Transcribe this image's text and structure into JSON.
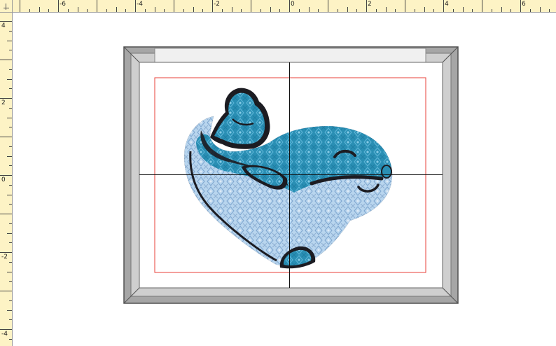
{
  "rulers": {
    "horizontal": {
      "origin_label": "0",
      "labels": [
        {
          "text": "-6",
          "value": -6
        },
        {
          "text": "-4",
          "value": -4
        },
        {
          "text": "-2",
          "value": -2
        },
        {
          "text": "0",
          "value": 0
        },
        {
          "text": "2",
          "value": 2
        },
        {
          "text": "4",
          "value": 4
        },
        {
          "text": "6",
          "value": 6
        }
      ]
    },
    "vertical": {
      "labels": [
        {
          "text": "4",
          "value": 4
        },
        {
          "text": "2",
          "value": 2
        },
        {
          "text": "0",
          "value": 0
        },
        {
          "text": "-2",
          "value": -2
        },
        {
          "text": "-4",
          "value": -4
        }
      ]
    }
  },
  "design": {
    "subject": "whale embroidery design",
    "colors": {
      "body_dark": "#2a8fb4",
      "body_light": "#b7d4ee",
      "outline": "#1c1c22",
      "hoop_frame": "#a6a6a6",
      "sewing_area": "#e8403a",
      "canvas_background": "#ffffff",
      "ruler_background": "#fdf3c5"
    }
  }
}
